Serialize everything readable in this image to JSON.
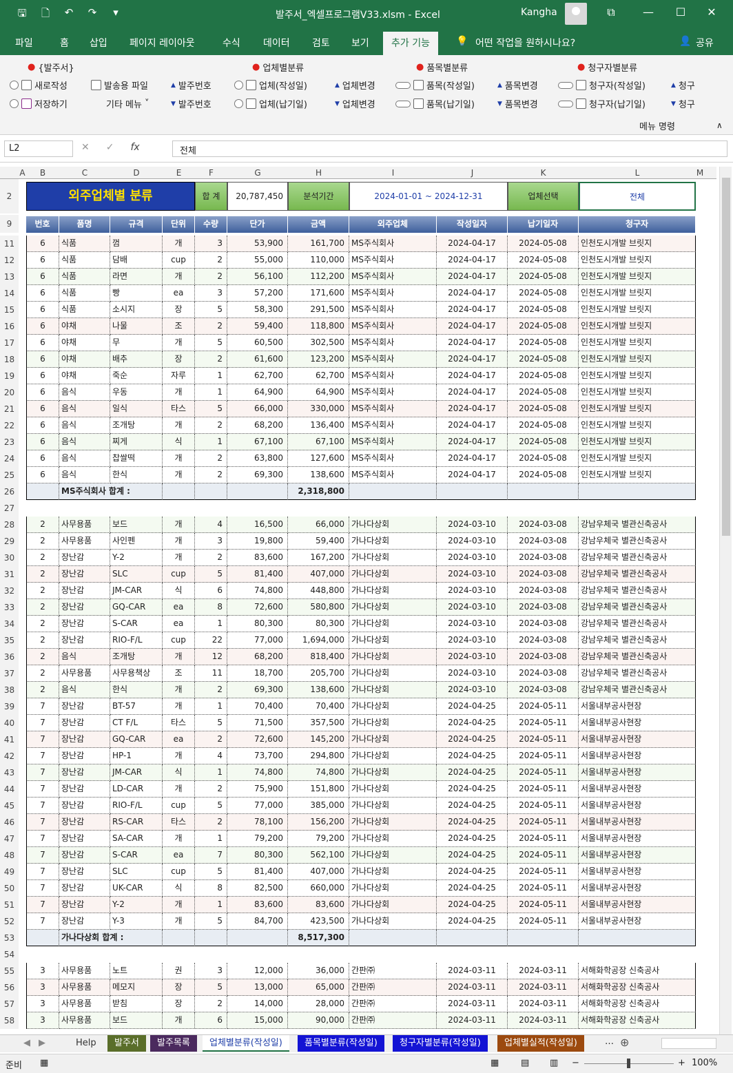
{
  "window": {
    "title": "발주서_엑셀프로그램V33.xlsm  -  Excel",
    "user": "Kangha",
    "qat": [
      "save-icon",
      "print-preview-icon",
      "undo-icon",
      "redo-icon",
      "customize-icon"
    ]
  },
  "tabs": [
    "파일",
    "홈",
    "삽입",
    "페이지 레이아웃",
    "수식",
    "데이터",
    "검토",
    "보기",
    "추가 기능"
  ],
  "active_tab": "추가 기능",
  "tell_me": "어떤 작업을 원하시나요?",
  "share": "공유",
  "ribbon": {
    "group1_title": "{발주서}",
    "new": "새로작성",
    "ship_file": "발송용 파일",
    "order_no_up": "발주번호",
    "save": "저장하기",
    "etc_menu": "기타 메뉴",
    "order_no_down": "발주번호",
    "group2_title": "업체별분류",
    "vendor_written": "업체(작성일)",
    "vendor_change_up": "업체변경",
    "vendor_delivery": "업체(납기일)",
    "vendor_change_down": "업체변경",
    "group3_title": "품목별분류",
    "item_written": "품목(작성일)",
    "item_change_up": "품목변경",
    "item_delivery": "품목(납기일)",
    "item_change_down": "품목변경",
    "group4_title": "청구자별분류",
    "claimant_written": "청구자(작성일)",
    "claimant_up": "청구",
    "claimant_delivery": "청구자(납기일)",
    "claimant_down": "청구",
    "footer": "메뉴 명령"
  },
  "formula_bar": {
    "name_box": "L2",
    "fx": "fx",
    "value": "전체"
  },
  "columns": [
    "A",
    "B",
    "C",
    "D",
    "E",
    "F",
    "G",
    "H",
    "I",
    "J",
    "K",
    "L",
    "M"
  ],
  "sheet_header": {
    "title": "외주업체별 분류",
    "total_label": "합 계",
    "total_value": "20,787,450",
    "period_label": "분석기간",
    "period_value": "2024-01-01  ~  2024-12-31",
    "vendor_select_label": "업체선택",
    "vendor_select_value": "전체"
  },
  "table_headers": [
    "번호",
    "품명",
    "규격",
    "단위",
    "수량",
    "단가",
    "금액",
    "외주업체",
    "작성일자",
    "납기일자",
    "청구자"
  ],
  "row_numbers": [
    "11",
    "12",
    "13",
    "14",
    "15",
    "16",
    "17",
    "18",
    "19",
    "20",
    "21",
    "22",
    "23",
    "24",
    "25",
    "26",
    "27",
    "28",
    "29",
    "30",
    "31",
    "32",
    "33",
    "34",
    "35",
    "36",
    "37",
    "38",
    "39",
    "40",
    "41",
    "42",
    "43",
    "44",
    "45",
    "46",
    "47",
    "48",
    "49",
    "50",
    "51",
    "52",
    "53",
    "54",
    "55",
    "56",
    "57",
    "58"
  ],
  "rows": [
    [
      "6",
      "식품",
      "껌",
      "개",
      "3",
      "53,900",
      "161,700",
      "MS주식회사",
      "2024-04-17",
      "2024-05-08",
      "인천도시개발 브릿지"
    ],
    [
      "6",
      "식품",
      "담배",
      "cup",
      "2",
      "55,000",
      "110,000",
      "MS주식회사",
      "2024-04-17",
      "2024-05-08",
      "인천도시개발 브릿지"
    ],
    [
      "6",
      "식품",
      "라면",
      "개",
      "2",
      "56,100",
      "112,200",
      "MS주식회사",
      "2024-04-17",
      "2024-05-08",
      "인천도시개발 브릿지"
    ],
    [
      "6",
      "식품",
      "빵",
      "ea",
      "3",
      "57,200",
      "171,600",
      "MS주식회사",
      "2024-04-17",
      "2024-05-08",
      "인천도시개발 브릿지"
    ],
    [
      "6",
      "식품",
      "소시지",
      "장",
      "5",
      "58,300",
      "291,500",
      "MS주식회사",
      "2024-04-17",
      "2024-05-08",
      "인천도시개발 브릿지"
    ],
    [
      "6",
      "야채",
      "나물",
      "조",
      "2",
      "59,400",
      "118,800",
      "MS주식회사",
      "2024-04-17",
      "2024-05-08",
      "인천도시개발 브릿지"
    ],
    [
      "6",
      "야채",
      "무",
      "개",
      "5",
      "60,500",
      "302,500",
      "MS주식회사",
      "2024-04-17",
      "2024-05-08",
      "인천도시개발 브릿지"
    ],
    [
      "6",
      "야채",
      "배추",
      "장",
      "2",
      "61,600",
      "123,200",
      "MS주식회사",
      "2024-04-17",
      "2024-05-08",
      "인천도시개발 브릿지"
    ],
    [
      "6",
      "야채",
      "죽순",
      "자루",
      "1",
      "62,700",
      "62,700",
      "MS주식회사",
      "2024-04-17",
      "2024-05-08",
      "인천도시개발 브릿지"
    ],
    [
      "6",
      "음식",
      "우동",
      "개",
      "1",
      "64,900",
      "64,900",
      "MS주식회사",
      "2024-04-17",
      "2024-05-08",
      "인천도시개발 브릿지"
    ],
    [
      "6",
      "음식",
      "일식",
      "타스",
      "5",
      "66,000",
      "330,000",
      "MS주식회사",
      "2024-04-17",
      "2024-05-08",
      "인천도시개발 브릿지"
    ],
    [
      "6",
      "음식",
      "조개탕",
      "개",
      "2",
      "68,200",
      "136,400",
      "MS주식회사",
      "2024-04-17",
      "2024-05-08",
      "인천도시개발 브릿지"
    ],
    [
      "6",
      "음식",
      "찌게",
      "식",
      "1",
      "67,100",
      "67,100",
      "MS주식회사",
      "2024-04-17",
      "2024-05-08",
      "인천도시개발 브릿지"
    ],
    [
      "6",
      "음식",
      "찹쌀떡",
      "개",
      "2",
      "63,800",
      "127,600",
      "MS주식회사",
      "2024-04-17",
      "2024-05-08",
      "인천도시개발 브릿지"
    ],
    [
      "6",
      "음식",
      "한식",
      "개",
      "2",
      "69,300",
      "138,600",
      "MS주식회사",
      "2024-04-17",
      "2024-05-08",
      "인천도시개발 브릿지"
    ],
    {
      "subtotal_label": "MS주식회사 합계  :",
      "subtotal_value": "2,318,800"
    },
    {
      "blank": true
    },
    [
      "2",
      "사무용품",
      "보드",
      "개",
      "4",
      "16,500",
      "66,000",
      "가나다상회",
      "2024-03-10",
      "2024-03-08",
      "강남우체국 별관신축공사"
    ],
    [
      "2",
      "사무용품",
      "사인펜",
      "개",
      "3",
      "19,800",
      "59,400",
      "가나다상회",
      "2024-03-10",
      "2024-03-08",
      "강남우체국 별관신축공사"
    ],
    [
      "2",
      "장난감",
      "Y-2",
      "개",
      "2",
      "83,600",
      "167,200",
      "가나다상회",
      "2024-03-10",
      "2024-03-08",
      "강남우체국 별관신축공사"
    ],
    [
      "2",
      "장난감",
      "SLC",
      "cup",
      "5",
      "81,400",
      "407,000",
      "가나다상회",
      "2024-03-10",
      "2024-03-08",
      "강남우체국 별관신축공사"
    ],
    [
      "2",
      "장난감",
      "JM-CAR",
      "식",
      "6",
      "74,800",
      "448,800",
      "가나다상회",
      "2024-03-10",
      "2024-03-08",
      "강남우체국 별관신축공사"
    ],
    [
      "2",
      "장난감",
      "GQ-CAR",
      "ea",
      "8",
      "72,600",
      "580,800",
      "가나다상회",
      "2024-03-10",
      "2024-03-08",
      "강남우체국 별관신축공사"
    ],
    [
      "2",
      "장난감",
      "S-CAR",
      "ea",
      "1",
      "80,300",
      "80,300",
      "가나다상회",
      "2024-03-10",
      "2024-03-08",
      "강남우체국 별관신축공사"
    ],
    [
      "2",
      "장난감",
      "RIO-F/L",
      "cup",
      "22",
      "77,000",
      "1,694,000",
      "가나다상회",
      "2024-03-10",
      "2024-03-08",
      "강남우체국 별관신축공사"
    ],
    [
      "2",
      "음식",
      "조개탕",
      "개",
      "12",
      "68,200",
      "818,400",
      "가나다상회",
      "2024-03-10",
      "2024-03-08",
      "강남우체국 별관신축공사"
    ],
    [
      "2",
      "사무용품",
      "사무용책상",
      "조",
      "11",
      "18,700",
      "205,700",
      "가나다상회",
      "2024-03-10",
      "2024-03-08",
      "강남우체국 별관신축공사"
    ],
    [
      "2",
      "음식",
      "한식",
      "개",
      "2",
      "69,300",
      "138,600",
      "가나다상회",
      "2024-03-10",
      "2024-03-08",
      "강남우체국 별관신축공사"
    ],
    [
      "7",
      "장난감",
      "BT-57",
      "개",
      "1",
      "70,400",
      "70,400",
      "가나다상회",
      "2024-04-25",
      "2024-05-11",
      "서울내부공사현장"
    ],
    [
      "7",
      "장난감",
      "CT F/L",
      "타스",
      "5",
      "71,500",
      "357,500",
      "가나다상회",
      "2024-04-25",
      "2024-05-11",
      "서울내부공사현장"
    ],
    [
      "7",
      "장난감",
      "GQ-CAR",
      "ea",
      "2",
      "72,600",
      "145,200",
      "가나다상회",
      "2024-04-25",
      "2024-05-11",
      "서울내부공사현장"
    ],
    [
      "7",
      "장난감",
      "HP-1",
      "개",
      "4",
      "73,700",
      "294,800",
      "가나다상회",
      "2024-04-25",
      "2024-05-11",
      "서울내부공사현장"
    ],
    [
      "7",
      "장난감",
      "JM-CAR",
      "식",
      "1",
      "74,800",
      "74,800",
      "가나다상회",
      "2024-04-25",
      "2024-05-11",
      "서울내부공사현장"
    ],
    [
      "7",
      "장난감",
      "LD-CAR",
      "개",
      "2",
      "75,900",
      "151,800",
      "가나다상회",
      "2024-04-25",
      "2024-05-11",
      "서울내부공사현장"
    ],
    [
      "7",
      "장난감",
      "RIO-F/L",
      "cup",
      "5",
      "77,000",
      "385,000",
      "가나다상회",
      "2024-04-25",
      "2024-05-11",
      "서울내부공사현장"
    ],
    [
      "7",
      "장난감",
      "RS-CAR",
      "타스",
      "2",
      "78,100",
      "156,200",
      "가나다상회",
      "2024-04-25",
      "2024-05-11",
      "서울내부공사현장"
    ],
    [
      "7",
      "장난감",
      "SA-CAR",
      "개",
      "1",
      "79,200",
      "79,200",
      "가나다상회",
      "2024-04-25",
      "2024-05-11",
      "서울내부공사현장"
    ],
    [
      "7",
      "장난감",
      "S-CAR",
      "ea",
      "7",
      "80,300",
      "562,100",
      "가나다상회",
      "2024-04-25",
      "2024-05-11",
      "서울내부공사현장"
    ],
    [
      "7",
      "장난감",
      "SLC",
      "cup",
      "5",
      "81,400",
      "407,000",
      "가나다상회",
      "2024-04-25",
      "2024-05-11",
      "서울내부공사현장"
    ],
    [
      "7",
      "장난감",
      "UK-CAR",
      "식",
      "8",
      "82,500",
      "660,000",
      "가나다상회",
      "2024-04-25",
      "2024-05-11",
      "서울내부공사현장"
    ],
    [
      "7",
      "장난감",
      "Y-2",
      "개",
      "1",
      "83,600",
      "83,600",
      "가나다상회",
      "2024-04-25",
      "2024-05-11",
      "서울내부공사현장"
    ],
    [
      "7",
      "장난감",
      "Y-3",
      "개",
      "5",
      "84,700",
      "423,500",
      "가나다상회",
      "2024-04-25",
      "2024-05-11",
      "서울내부공사현장"
    ],
    {
      "subtotal_label": "가나다상회 합계  :",
      "subtotal_value": "8,517,300"
    },
    {
      "blank": true
    },
    [
      "3",
      "사무용품",
      "노트",
      "권",
      "3",
      "12,000",
      "36,000",
      "간판㈜",
      "2024-03-11",
      "2024-03-11",
      "서해화학공장 신축공사"
    ],
    [
      "3",
      "사무용품",
      "메모지",
      "장",
      "5",
      "13,000",
      "65,000",
      "간판㈜",
      "2024-03-11",
      "2024-03-11",
      "서해화학공장 신축공사"
    ],
    [
      "3",
      "사무용품",
      "받침",
      "장",
      "2",
      "14,000",
      "28,000",
      "간판㈜",
      "2024-03-11",
      "2024-03-11",
      "서해화학공장 신축공사"
    ],
    [
      "3",
      "사무용품",
      "보드",
      "개",
      "6",
      "15,000",
      "90,000",
      "간판㈜",
      "2024-03-11",
      "2024-03-11",
      "서해화학공장 신축공사"
    ]
  ],
  "sheet_tabs": [
    {
      "label": "Help",
      "color": "#f0f0f0",
      "text": "#333"
    },
    {
      "label": "발주서",
      "color": "#5a6e2a",
      "text": "#fff"
    },
    {
      "label": "발주목록",
      "color": "#4b2a5e",
      "text": "#fff"
    },
    {
      "label": "업체별분류(작성일)",
      "color": "#ffffff",
      "text": "#1f3ea8"
    },
    {
      "label": "품목별분류(작성일)",
      "color": "#1414d4",
      "text": "#fff"
    },
    {
      "label": "청구자별분류(작성일)",
      "color": "#1414d4",
      "text": "#fff"
    },
    {
      "label": "업체별실적(작성일)",
      "color": "#9c4a0f",
      "text": "#fff"
    }
  ],
  "status": {
    "ready": "준비",
    "zoom": "100%"
  }
}
